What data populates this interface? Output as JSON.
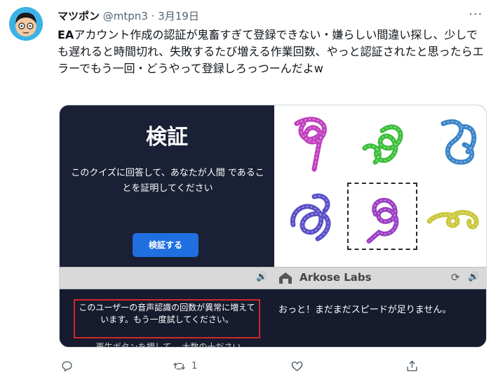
{
  "tweet": {
    "display_name": "マツポン",
    "handle": "@mtpn3",
    "separator": " · ",
    "date": "3月19日",
    "more_label": "···",
    "text_bold": "EA",
    "text_rest": "アカウント作成の認証が鬼畜すぎて登録できない・嫌らしい間違い探し、少しでも遅れると時間切れ、失敗するたび増える作業回数、やっと認証されたと思ったらエラーでもう一回・どうやって登録しろっつーんだよw"
  },
  "captcha": {
    "title": "検証",
    "instruction": "このクイズに回答して、あなたが人間 であることを証明してください",
    "button_label": "検証する",
    "brand_name": "Arkose Labs",
    "warning": "このユーザーの音声認識の回数が異常に増えています。もう一度試してください。",
    "cut_off_text": "再生ボタンを押して、 大数の十ださい",
    "message": "おっと！まだまだスピードが足りません。",
    "tiles": [
      {
        "color": "#c03fbf",
        "selected": false
      },
      {
        "color": "#3bbf3b",
        "selected": false
      },
      {
        "color": "#3a84c9",
        "selected": false
      },
      {
        "color": "#5a4fc7",
        "selected": false
      },
      {
        "color": "#9a3fc4",
        "selected": true
      },
      {
        "color": "#c9c73a",
        "selected": false
      }
    ]
  },
  "actions": {
    "reply_count": "",
    "retweet_count": "1",
    "like_count": ""
  },
  "colors": {
    "panel_dark": "#1a2035",
    "button_blue": "#1f6fe0",
    "warning_red": "#d0282a",
    "avatar_bg": "#3bb2e6"
  }
}
